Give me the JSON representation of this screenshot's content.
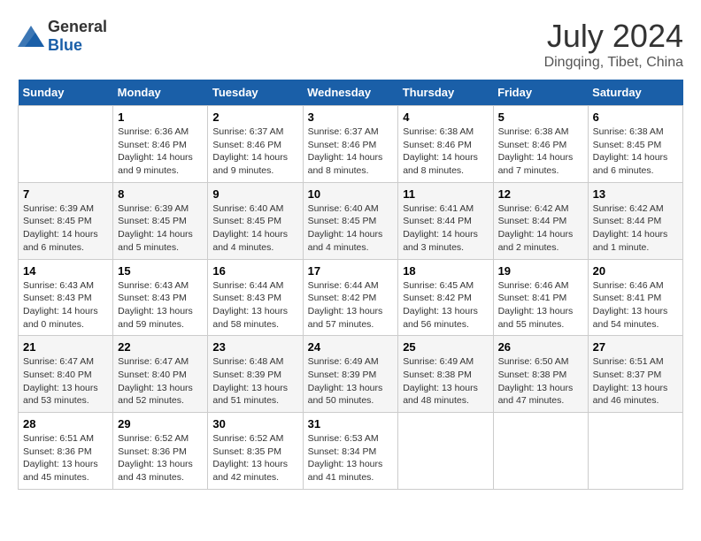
{
  "header": {
    "logo_general": "General",
    "logo_blue": "Blue",
    "main_title": "July 2024",
    "subtitle": "Dingqing, Tibet, China"
  },
  "days_of_week": [
    "Sunday",
    "Monday",
    "Tuesday",
    "Wednesday",
    "Thursday",
    "Friday",
    "Saturday"
  ],
  "weeks": [
    [
      {
        "day": "",
        "info": ""
      },
      {
        "day": "1",
        "info": "Sunrise: 6:36 AM\nSunset: 8:46 PM\nDaylight: 14 hours and 9 minutes."
      },
      {
        "day": "2",
        "info": "Sunrise: 6:37 AM\nSunset: 8:46 PM\nDaylight: 14 hours and 9 minutes."
      },
      {
        "day": "3",
        "info": "Sunrise: 6:37 AM\nSunset: 8:46 PM\nDaylight: 14 hours and 8 minutes."
      },
      {
        "day": "4",
        "info": "Sunrise: 6:38 AM\nSunset: 8:46 PM\nDaylight: 14 hours and 8 minutes."
      },
      {
        "day": "5",
        "info": "Sunrise: 6:38 AM\nSunset: 8:46 PM\nDaylight: 14 hours and 7 minutes."
      },
      {
        "day": "6",
        "info": "Sunrise: 6:38 AM\nSunset: 8:45 PM\nDaylight: 14 hours and 6 minutes."
      }
    ],
    [
      {
        "day": "7",
        "info": "Sunrise: 6:39 AM\nSunset: 8:45 PM\nDaylight: 14 hours and 6 minutes."
      },
      {
        "day": "8",
        "info": "Sunrise: 6:39 AM\nSunset: 8:45 PM\nDaylight: 14 hours and 5 minutes."
      },
      {
        "day": "9",
        "info": "Sunrise: 6:40 AM\nSunset: 8:45 PM\nDaylight: 14 hours and 4 minutes."
      },
      {
        "day": "10",
        "info": "Sunrise: 6:40 AM\nSunset: 8:45 PM\nDaylight: 14 hours and 4 minutes."
      },
      {
        "day": "11",
        "info": "Sunrise: 6:41 AM\nSunset: 8:44 PM\nDaylight: 14 hours and 3 minutes."
      },
      {
        "day": "12",
        "info": "Sunrise: 6:42 AM\nSunset: 8:44 PM\nDaylight: 14 hours and 2 minutes."
      },
      {
        "day": "13",
        "info": "Sunrise: 6:42 AM\nSunset: 8:44 PM\nDaylight: 14 hours and 1 minute."
      }
    ],
    [
      {
        "day": "14",
        "info": "Sunrise: 6:43 AM\nSunset: 8:43 PM\nDaylight: 14 hours and 0 minutes."
      },
      {
        "day": "15",
        "info": "Sunrise: 6:43 AM\nSunset: 8:43 PM\nDaylight: 13 hours and 59 minutes."
      },
      {
        "day": "16",
        "info": "Sunrise: 6:44 AM\nSunset: 8:43 PM\nDaylight: 13 hours and 58 minutes."
      },
      {
        "day": "17",
        "info": "Sunrise: 6:44 AM\nSunset: 8:42 PM\nDaylight: 13 hours and 57 minutes."
      },
      {
        "day": "18",
        "info": "Sunrise: 6:45 AM\nSunset: 8:42 PM\nDaylight: 13 hours and 56 minutes."
      },
      {
        "day": "19",
        "info": "Sunrise: 6:46 AM\nSunset: 8:41 PM\nDaylight: 13 hours and 55 minutes."
      },
      {
        "day": "20",
        "info": "Sunrise: 6:46 AM\nSunset: 8:41 PM\nDaylight: 13 hours and 54 minutes."
      }
    ],
    [
      {
        "day": "21",
        "info": "Sunrise: 6:47 AM\nSunset: 8:40 PM\nDaylight: 13 hours and 53 minutes."
      },
      {
        "day": "22",
        "info": "Sunrise: 6:47 AM\nSunset: 8:40 PM\nDaylight: 13 hours and 52 minutes."
      },
      {
        "day": "23",
        "info": "Sunrise: 6:48 AM\nSunset: 8:39 PM\nDaylight: 13 hours and 51 minutes."
      },
      {
        "day": "24",
        "info": "Sunrise: 6:49 AM\nSunset: 8:39 PM\nDaylight: 13 hours and 50 minutes."
      },
      {
        "day": "25",
        "info": "Sunrise: 6:49 AM\nSunset: 8:38 PM\nDaylight: 13 hours and 48 minutes."
      },
      {
        "day": "26",
        "info": "Sunrise: 6:50 AM\nSunset: 8:38 PM\nDaylight: 13 hours and 47 minutes."
      },
      {
        "day": "27",
        "info": "Sunrise: 6:51 AM\nSunset: 8:37 PM\nDaylight: 13 hours and 46 minutes."
      }
    ],
    [
      {
        "day": "28",
        "info": "Sunrise: 6:51 AM\nSunset: 8:36 PM\nDaylight: 13 hours and 45 minutes."
      },
      {
        "day": "29",
        "info": "Sunrise: 6:52 AM\nSunset: 8:36 PM\nDaylight: 13 hours and 43 minutes."
      },
      {
        "day": "30",
        "info": "Sunrise: 6:52 AM\nSunset: 8:35 PM\nDaylight: 13 hours and 42 minutes."
      },
      {
        "day": "31",
        "info": "Sunrise: 6:53 AM\nSunset: 8:34 PM\nDaylight: 13 hours and 41 minutes."
      },
      {
        "day": "",
        "info": ""
      },
      {
        "day": "",
        "info": ""
      },
      {
        "day": "",
        "info": ""
      }
    ]
  ]
}
